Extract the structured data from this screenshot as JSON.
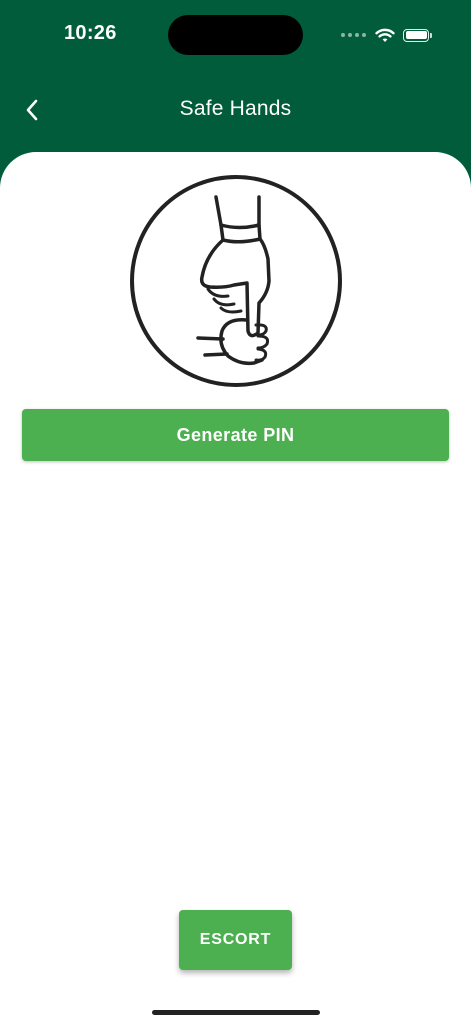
{
  "status_bar": {
    "time": "10:26",
    "icons": [
      "signal-icon",
      "wifi-icon",
      "battery-icon"
    ]
  },
  "header": {
    "back_icon": "chevron-left-icon",
    "title": "Safe Hands"
  },
  "hero": {
    "icon": "hands-handshake-icon"
  },
  "actions": {
    "generate_label": "Generate PIN",
    "escort_label": "ESCORT"
  },
  "colors": {
    "header_bg": "#005c3a",
    "primary_button": "#4caf50",
    "surface": "#ffffff",
    "illustration_stroke": "#222222"
  }
}
